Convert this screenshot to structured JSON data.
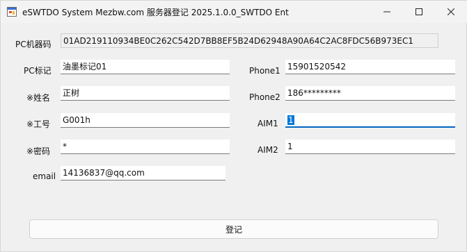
{
  "window": {
    "title": "eSWTDO System Mezbw.com 服务器登记  2025.1.0.0_SWTDO Ent",
    "app_icon": "app-window-icon",
    "controls": [
      "minimize-icon",
      "maximize-icon",
      "close-icon"
    ]
  },
  "form": {
    "pc_id_label": "PC机器码",
    "pc_id_value": "01AD219110934BE0C262C542D7BB8EF5B24D62948A90A64C2AC8FDC56B973EC1",
    "pc_tag_label": "PC标记",
    "pc_tag_value": "油墨标记01",
    "name_label": "※姓名",
    "name_value": "正树",
    "job_id_label": "※工号",
    "job_id_value": "G001h",
    "password_label": "※密码",
    "password_value": "*",
    "email_label": "email",
    "email_value": "14136837@qq.com",
    "phone1_label": "Phone1",
    "phone1_value": "15901520542",
    "phone2_label": "Phone2",
    "phone2_value": "186*********",
    "aim1_label": "AIM1",
    "aim1_value": "1",
    "aim2_label": "AIM2",
    "aim2_value": "1"
  },
  "actions": {
    "register_label": "登记"
  },
  "colors": {
    "focus_accent": "#0067c0",
    "selection": "#0078d7"
  }
}
